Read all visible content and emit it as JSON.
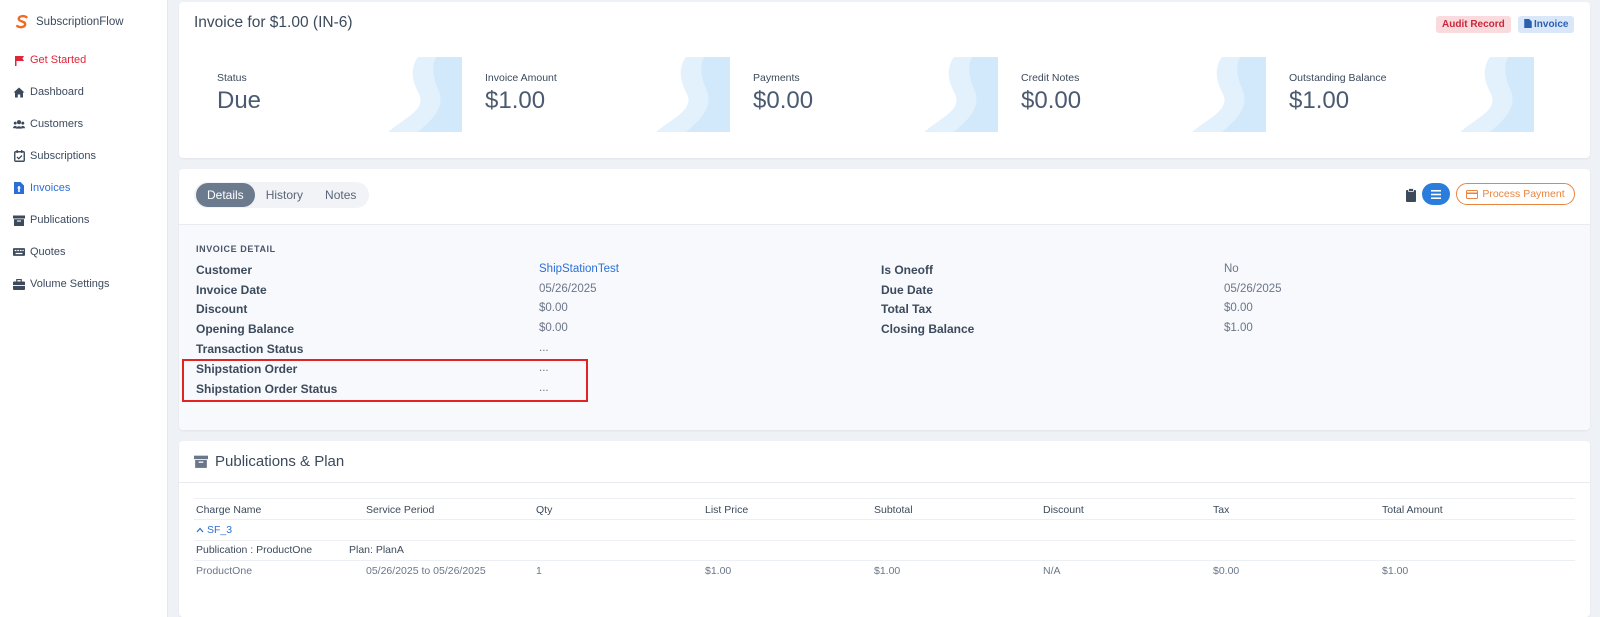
{
  "brand": {
    "name": "SubscriptionFlow",
    "accent": "#f26a21"
  },
  "sidebar": {
    "items": [
      {
        "label": "Get Started",
        "icon": "flag-icon"
      },
      {
        "label": "Dashboard",
        "icon": "home-icon"
      },
      {
        "label": "Customers",
        "icon": "users-icon"
      },
      {
        "label": "Subscriptions",
        "icon": "calendar-check-icon"
      },
      {
        "label": "Invoices",
        "icon": "file-invoice-icon"
      },
      {
        "label": "Publications",
        "icon": "archive-icon"
      },
      {
        "label": "Quotes",
        "icon": "keyboard-icon"
      },
      {
        "label": "Volume Settings",
        "icon": "briefcase-icon"
      }
    ],
    "active": "Invoices"
  },
  "header": {
    "title": "Invoice for $1.00 (IN-6)",
    "audit_label": "Audit Record",
    "invoice_label": "Invoice"
  },
  "stats": [
    {
      "label": "Status",
      "value": "Due"
    },
    {
      "label": "Invoice Amount",
      "value": "$1.00"
    },
    {
      "label": "Payments",
      "value": "$0.00"
    },
    {
      "label": "Credit Notes",
      "value": "$0.00"
    },
    {
      "label": "Outstanding Balance",
      "value": "$1.00"
    }
  ],
  "details": {
    "tabs": [
      "Details",
      "History",
      "Notes"
    ],
    "active_tab": "Details",
    "process_payment_label": "Process Payment",
    "section_label": "INVOICE DETAIL",
    "left_fields": [
      {
        "label": "Customer",
        "value": "ShipStationTest"
      },
      {
        "label": "Invoice Date",
        "value": "05/26/2025"
      },
      {
        "label": "Discount",
        "value": "$0.00"
      },
      {
        "label": "Opening Balance",
        "value": "$0.00"
      },
      {
        "label": "Transaction Status",
        "value": "..."
      },
      {
        "label": "Shipstation Order",
        "value": "..."
      },
      {
        "label": "Shipstation Order Status",
        "value": "..."
      }
    ],
    "right_fields": [
      {
        "label": "Is Oneoff",
        "value": "No"
      },
      {
        "label": "Due Date",
        "value": "05/26/2025"
      },
      {
        "label": "Total Tax",
        "value": "$0.00"
      },
      {
        "label": "Closing Balance",
        "value": "$1.00"
      }
    ]
  },
  "publications": {
    "title": "Publications & Plan",
    "columns": [
      "Charge Name",
      "Service Period",
      "Qty",
      "List Price",
      "Subtotal",
      "Discount",
      "Tax",
      "Total Amount"
    ],
    "group": "SF_3",
    "publication": "Publication : ProductOne",
    "plan": "Plan: PlanA",
    "rows": [
      [
        "ProductOne",
        "05/26/2025 to 05/26/2025",
        "1",
        "$1.00",
        "$1.00",
        "N/A",
        "$0.00",
        "$1.00"
      ]
    ]
  }
}
